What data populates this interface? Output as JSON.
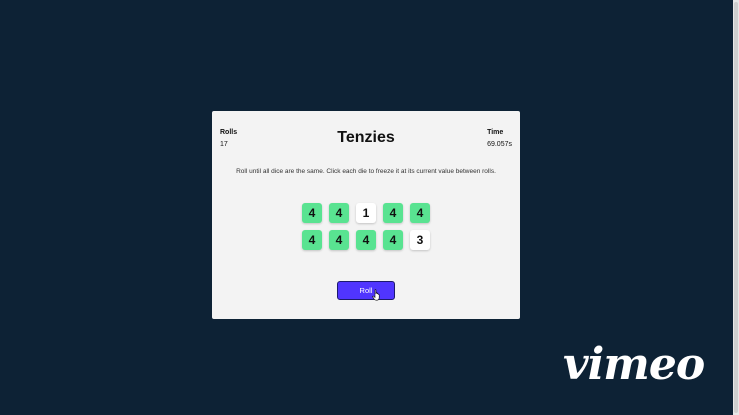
{
  "game": {
    "title": "Tenzies",
    "rolls_label": "Rolls",
    "rolls_value": "17",
    "time_label": "Time",
    "time_value": "69.057s",
    "instructions": "Roll until all dice are the same. Click each die to freeze it at its current value between rolls.",
    "dice": [
      {
        "value": "4",
        "held": true
      },
      {
        "value": "4",
        "held": true
      },
      {
        "value": "1",
        "held": false
      },
      {
        "value": "4",
        "held": true
      },
      {
        "value": "4",
        "held": true
      },
      {
        "value": "4",
        "held": true
      },
      {
        "value": "4",
        "held": true
      },
      {
        "value": "4",
        "held": true
      },
      {
        "value": "4",
        "held": true
      },
      {
        "value": "3",
        "held": false
      }
    ],
    "roll_button_label": "Roll"
  },
  "watermark": {
    "text": "vimeo"
  },
  "colors": {
    "background": "#0d2235",
    "card": "#f3f3f3",
    "held_die": "#59e391",
    "free_die": "#ffffff",
    "roll_button": "#5035ff"
  }
}
